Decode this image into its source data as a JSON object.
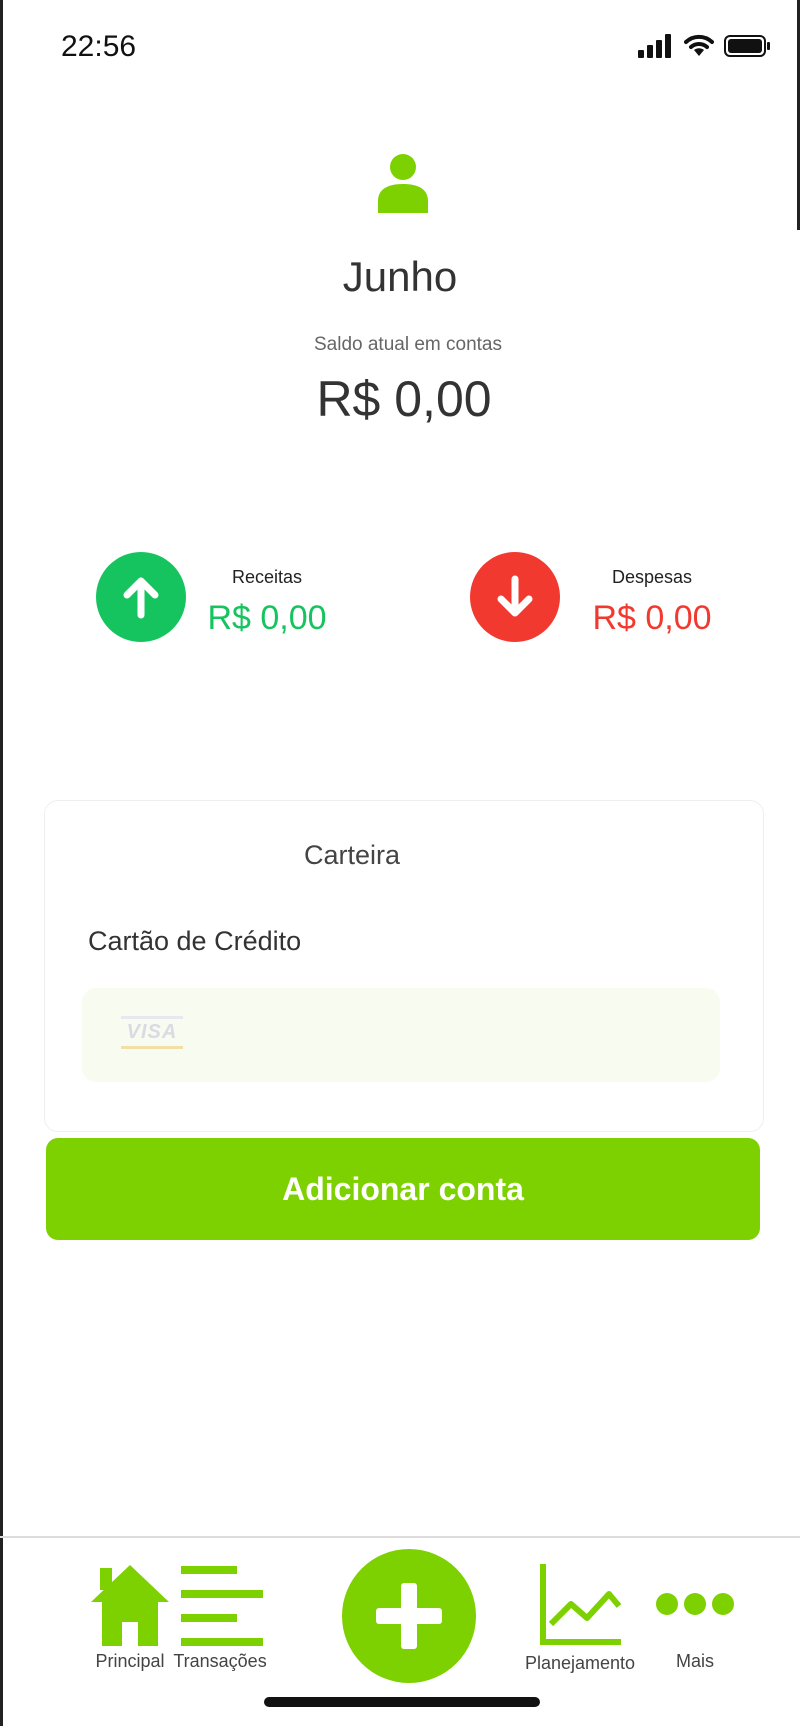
{
  "status_bar": {
    "time": "22:56"
  },
  "header": {
    "month": "Junho",
    "balance_label": "Saldo atual em contas",
    "balance_value": "R$ 0,00"
  },
  "summary": {
    "income": {
      "label": "Receitas",
      "value": "R$ 0,00"
    },
    "expenses": {
      "label": "Despesas",
      "value": "R$ 0,00"
    }
  },
  "wallet": {
    "title": "Carteira",
    "subtitle": "Cartão de Crédito",
    "card_brand": "VISA",
    "add_button_label": "Adicionar conta"
  },
  "bottom_nav": {
    "items": [
      {
        "label": "Principal",
        "icon": "home-icon"
      },
      {
        "label": "Transações",
        "icon": "list-icon"
      },
      {
        "label": "",
        "icon": "plus-icon"
      },
      {
        "label": "Planejamento",
        "icon": "chart-icon"
      },
      {
        "label": "Mais",
        "icon": "more-icon"
      }
    ]
  },
  "colors": {
    "accent": "#7ED100",
    "income": "#15C45E",
    "expense": "#F2392F"
  }
}
